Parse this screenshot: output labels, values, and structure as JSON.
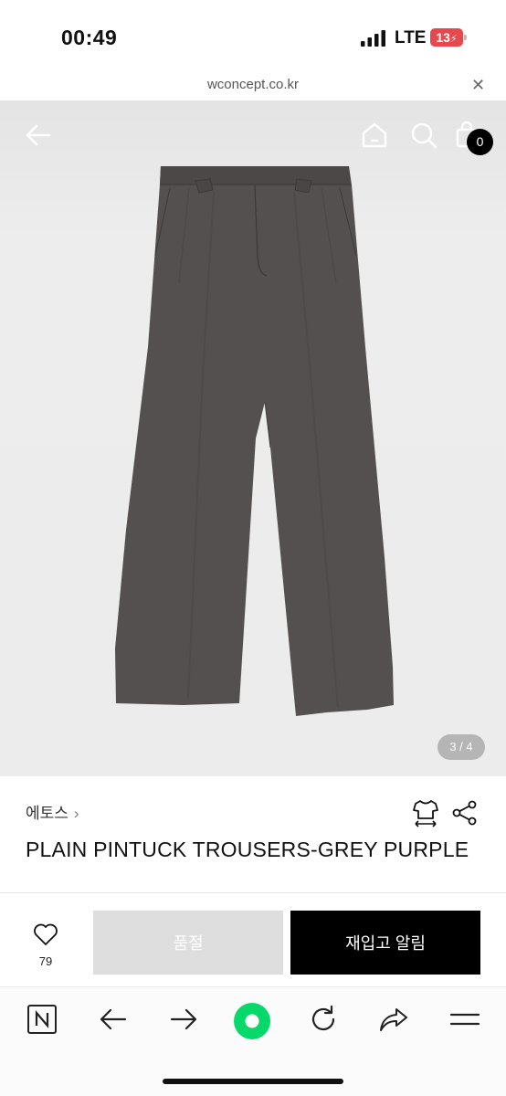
{
  "status_bar": {
    "time": "00:49",
    "network": "LTE",
    "battery": "13"
  },
  "browser": {
    "url": "wconcept.co.kr",
    "close_icon": "close-icon"
  },
  "header": {
    "back_icon": "arrow-left-icon",
    "home_icon": "home-icon",
    "search_icon": "search-icon",
    "bag_icon": "shopping-bag-icon",
    "cart_count": "0"
  },
  "gallery": {
    "counter": "3 / 4",
    "pants_color": "#54504f"
  },
  "product": {
    "brand": "에토스",
    "brand_chevron": "›",
    "name": "PLAIN PINTUCK TROUSERS-GREY PURPLE",
    "size_icon": "size-guide-icon",
    "share_icon": "share-icon"
  },
  "actions": {
    "like_count": "79",
    "soldout_label": "품절",
    "restock_label": "재입고 알림"
  },
  "toolbar": {
    "items": [
      "naver-n-icon",
      "back-arrow-icon",
      "forward-arrow-icon",
      "green-dot-icon",
      "refresh-icon",
      "share-arrow-icon",
      "menu-icon"
    ],
    "accent": "#06d96a"
  }
}
